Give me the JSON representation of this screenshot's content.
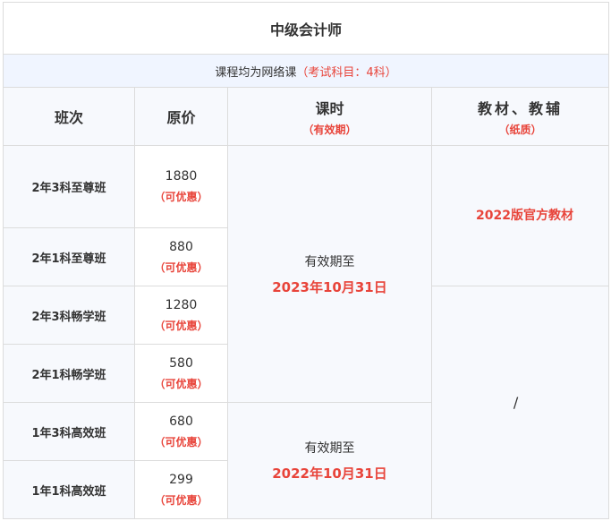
{
  "title": "中级会计师",
  "note": {
    "text": "课程均为网络课",
    "highlight": "（考试科目：4科）"
  },
  "headers": {
    "class": "班次",
    "price": "原价",
    "hours": "课时",
    "hours_sub": "（有效期）",
    "materials": "教材、教辅",
    "materials_sub": "（纸质）"
  },
  "rows": [
    {
      "name": "2年3科至尊班",
      "price": "1880",
      "discount": "（可优惠）"
    },
    {
      "name": "2年1科至尊班",
      "price": "880",
      "discount": "（可优惠）"
    },
    {
      "name": "2年3科畅学班",
      "price": "1280",
      "discount": "（可优惠）"
    },
    {
      "name": "2年1科畅学班",
      "price": "580",
      "discount": "（可优惠）"
    },
    {
      "name": "1年3科高效班",
      "price": "680",
      "discount": "（可优惠）"
    },
    {
      "name": "1年1科高效班",
      "price": "299",
      "discount": "（可优惠）"
    }
  ],
  "validity": [
    {
      "label": "有效期至",
      "date": "2023年10月31日"
    },
    {
      "label": "有效期至",
      "date": "2022年10月31日"
    }
  ],
  "materials": {
    "with_book": "2022版官方教材",
    "none": "/"
  }
}
